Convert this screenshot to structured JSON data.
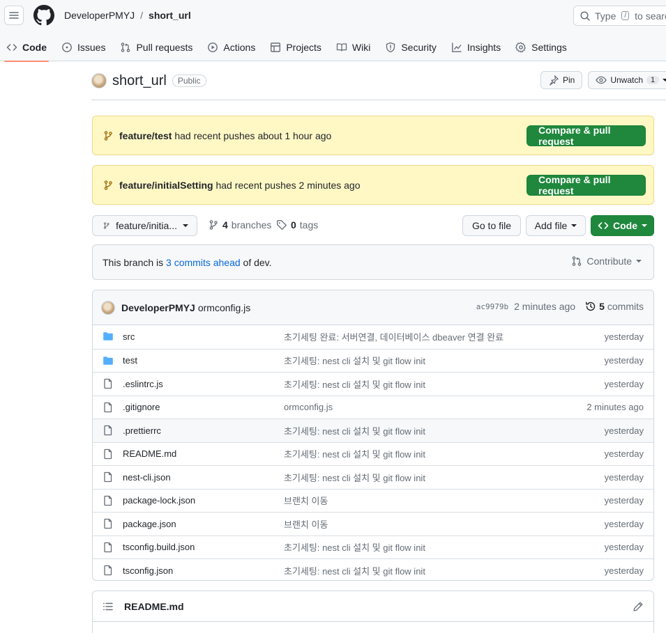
{
  "header": {
    "owner": "DeveloperPMYJ",
    "separator": "/",
    "repo": "short_url",
    "search_prefix": "Type",
    "search_key": "/",
    "search_suffix": "to search"
  },
  "nav": [
    {
      "label": "Code",
      "icon": "code-icon",
      "active": true
    },
    {
      "label": "Issues",
      "icon": "issue-icon"
    },
    {
      "label": "Pull requests",
      "icon": "pull-request-icon"
    },
    {
      "label": "Actions",
      "icon": "play-icon"
    },
    {
      "label": "Projects",
      "icon": "table-icon"
    },
    {
      "label": "Wiki",
      "icon": "book-icon"
    },
    {
      "label": "Security",
      "icon": "shield-icon"
    },
    {
      "label": "Insights",
      "icon": "graph-icon"
    },
    {
      "label": "Settings",
      "icon": "gear-icon"
    }
  ],
  "repo_header": {
    "name": "short_url",
    "visibility": "Public",
    "pin_label": "Pin",
    "unwatch_label": "Unwatch",
    "watch_count": "1"
  },
  "flashes": [
    {
      "branch": "feature/test",
      "text": "had recent pushes about 1 hour ago",
      "button": "Compare & pull request"
    },
    {
      "branch": "feature/initialSetting",
      "text": "had recent pushes 2 minutes ago",
      "button": "Compare & pull request"
    }
  ],
  "branch_bar": {
    "current_branch": "feature/initia...",
    "branches_count": "4",
    "branches_label": "branches",
    "tags_count": "0",
    "tags_label": "tags",
    "go_to_file": "Go to file",
    "add_file": "Add file",
    "code": "Code"
  },
  "ahead": {
    "prefix": "This branch is",
    "link": "3 commits ahead",
    "suffix": "of dev.",
    "contribute": "Contribute"
  },
  "latest_commit": {
    "author": "DeveloperPMYJ",
    "message": "ormconfig.js",
    "sha": "ac9979b",
    "time": "2 minutes ago",
    "commit_count": "5",
    "commits_label": "commits"
  },
  "files": [
    {
      "type": "dir",
      "name": "src",
      "message": "초기세팅 완료: 서버연결, 데이터베이스 dbeaver 연결 완료",
      "age": "yesterday"
    },
    {
      "type": "dir",
      "name": "test",
      "message": "초기세팅: nest cli 설치 및 git flow init",
      "age": "yesterday"
    },
    {
      "type": "file",
      "name": ".eslintrc.js",
      "message": "초기세팅: nest cli 설치 및 git flow init",
      "age": "yesterday"
    },
    {
      "type": "file",
      "name": ".gitignore",
      "message": "ormconfig.js",
      "age": "2 minutes ago"
    },
    {
      "type": "file",
      "name": ".prettierrc",
      "message": "초기세팅: nest cli 설치 및 git flow init",
      "age": "yesterday",
      "highlight": true
    },
    {
      "type": "file",
      "name": "README.md",
      "message": "초기세팅: nest cli 설치 및 git flow init",
      "age": "yesterday"
    },
    {
      "type": "file",
      "name": "nest-cli.json",
      "message": "초기세팅: nest cli 설치 및 git flow init",
      "age": "yesterday"
    },
    {
      "type": "file",
      "name": "package-lock.json",
      "message": "브랜치 이동",
      "age": "yesterday"
    },
    {
      "type": "file",
      "name": "package.json",
      "message": "브랜치 이동",
      "age": "yesterday"
    },
    {
      "type": "file",
      "name": "tsconfig.build.json",
      "message": "초기세팅: nest cli 설치 및 git flow init",
      "age": "yesterday"
    },
    {
      "type": "file",
      "name": "tsconfig.json",
      "message": "초기세팅: nest cli 설치 및 git flow init",
      "age": "yesterday"
    }
  ],
  "readme": {
    "title": "README.md"
  },
  "colors": {
    "green": "#1f883d",
    "flash_bg": "#fff8c5",
    "link": "#0969da",
    "folder": "#54aeff",
    "active_underline": "#fd8c73"
  }
}
